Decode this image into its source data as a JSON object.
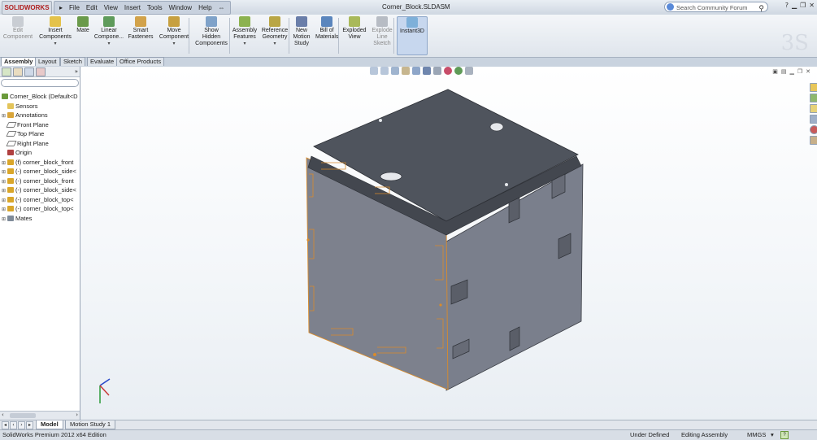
{
  "app": {
    "logo": "SOLIDWORKS",
    "doc_title": "Corner_Block.SLDASM",
    "menu": [
      "File",
      "Edit",
      "View",
      "Insert",
      "Tools",
      "Window",
      "Help"
    ],
    "search_placeholder": "Search Community Forum"
  },
  "commands": [
    {
      "l1": "Edit",
      "l2": "Component",
      "l3": "",
      "icon": "edit-component-icon",
      "disabled": true
    },
    {
      "l1": "Insert",
      "l2": "Components",
      "l3": "",
      "icon": "insert-components-icon",
      "dropdown": true
    },
    {
      "l1": "Mate",
      "l2": "",
      "l3": "",
      "icon": "mate-icon"
    },
    {
      "l1": "Linear",
      "l2": "Compone...",
      "l3": "",
      "icon": "linear-pattern-icon",
      "dropdown": true
    },
    {
      "l1": "Smart",
      "l2": "Fasteners",
      "l3": "",
      "icon": "smart-fasteners-icon"
    },
    {
      "l1": "Move",
      "l2": "Component",
      "l3": "",
      "icon": "move-component-icon",
      "dropdown": true
    },
    {
      "l1": "Show",
      "l2": "Hidden",
      "l3": "Components",
      "icon": "show-hidden-icon"
    },
    {
      "l1": "Assembly",
      "l2": "Features",
      "l3": "",
      "icon": "assembly-features-icon",
      "dropdown": true
    },
    {
      "l1": "Reference",
      "l2": "Geometry",
      "l3": "",
      "icon": "reference-geometry-icon",
      "dropdown": true
    },
    {
      "l1": "New",
      "l2": "Motion",
      "l3": "Study",
      "icon": "new-motion-study-icon"
    },
    {
      "l1": "Bill of",
      "l2": "Materials",
      "l3": "",
      "icon": "bill-of-materials-icon"
    },
    {
      "l1": "Exploded",
      "l2": "View",
      "l3": "",
      "icon": "exploded-view-icon"
    },
    {
      "l1": "Explode",
      "l2": "Line",
      "l3": "Sketch",
      "icon": "explode-line-sketch-icon",
      "disabled": true
    },
    {
      "l1": "Instant3D",
      "l2": "",
      "l3": "",
      "icon": "instant3d-icon",
      "active": true
    }
  ],
  "tabs": [
    "Assembly",
    "Layout",
    "Sketch",
    "Evaluate",
    "Office Products"
  ],
  "tree": [
    {
      "label": "Corner_Block  (Default<D",
      "level": 0,
      "icon": "assembly-icon",
      "plus": false
    },
    {
      "label": "Sensors",
      "level": 1,
      "icon": "sensors-folder-icon",
      "plus": false
    },
    {
      "label": "Annotations",
      "level": 1,
      "icon": "annotations-icon",
      "plus": true
    },
    {
      "label": "Front Plane",
      "level": 1,
      "icon": "plane-icon",
      "plus": false
    },
    {
      "label": "Top Plane",
      "level": 1,
      "icon": "plane-icon",
      "plus": false
    },
    {
      "label": "Right Plane",
      "level": 1,
      "icon": "plane-icon",
      "plus": false
    },
    {
      "label": "Origin",
      "level": 1,
      "icon": "origin-icon",
      "plus": false
    },
    {
      "label": "(f) corner_block_front",
      "level": 1,
      "icon": "part-icon",
      "plus": true
    },
    {
      "label": "(-) corner_block_side<",
      "level": 1,
      "icon": "part-icon",
      "plus": true
    },
    {
      "label": "(-) corner_block_front",
      "level": 1,
      "icon": "part-icon",
      "plus": true
    },
    {
      "label": "(-) corner_block_side<",
      "level": 1,
      "icon": "part-icon",
      "plus": true
    },
    {
      "label": "(-) corner_block_top<",
      "level": 1,
      "icon": "part-icon",
      "plus": true
    },
    {
      "label": "(-) corner_block_top<",
      "level": 1,
      "icon": "part-icon",
      "plus": true
    },
    {
      "label": "Mates",
      "level": 1,
      "icon": "mates-icon",
      "plus": true
    }
  ],
  "bottom_tabs": [
    "Model",
    "Motion Study 1"
  ],
  "status": {
    "edition": "SolidWorks Premium 2012 x64 Edition",
    "state": "Under Defined",
    "mode": "Editing Assembly",
    "units": "MMGS",
    "units_arrow": "▾",
    "help": "?"
  },
  "colors": {
    "cube_top": "#4e535c",
    "cube_left": "#7b808c",
    "cube_right": "#777c89",
    "selection_edge": "#d98b2b"
  }
}
